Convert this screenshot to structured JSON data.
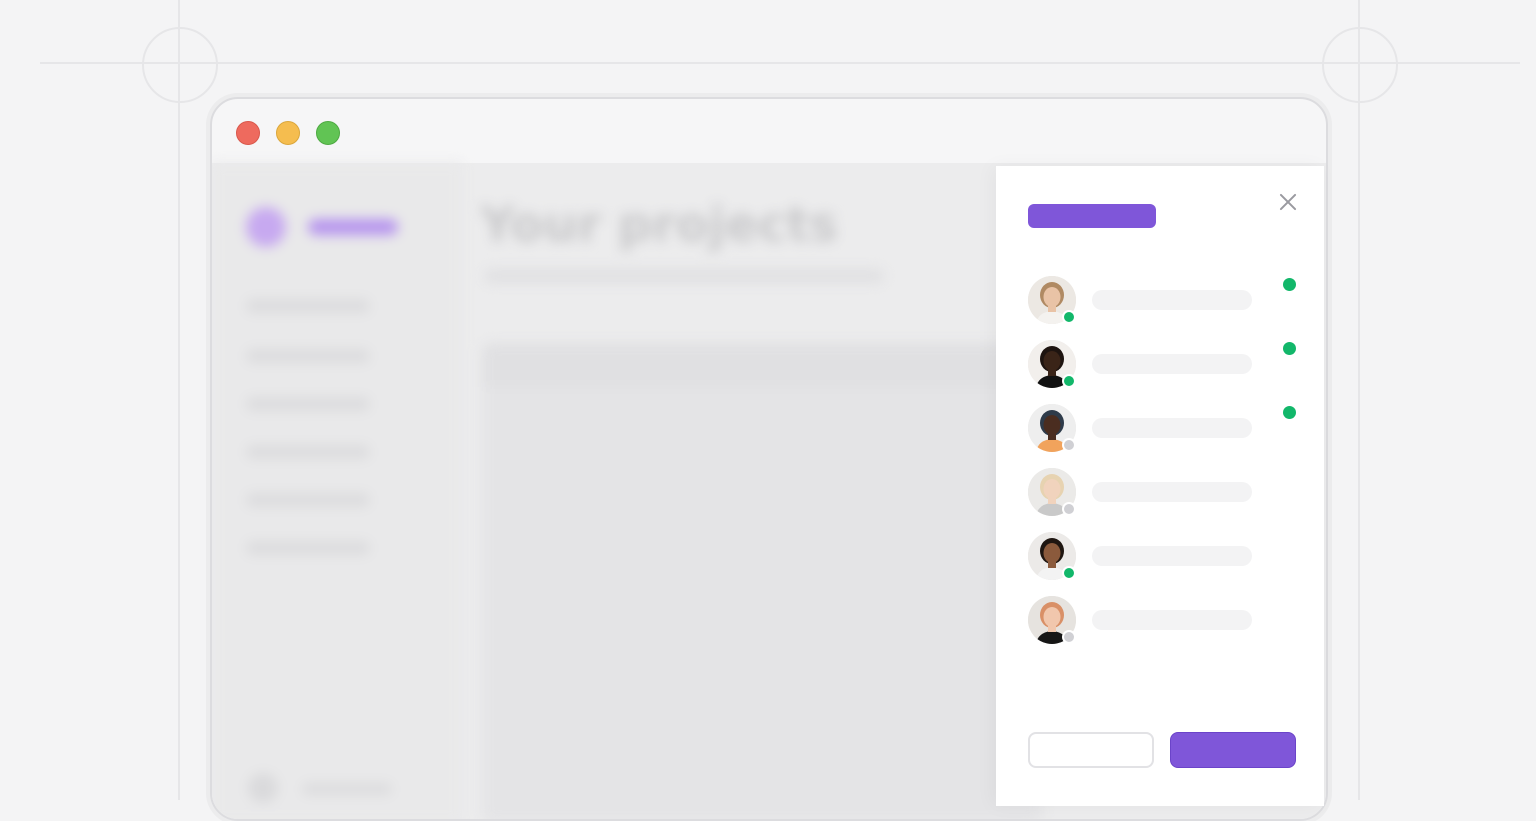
{
  "background_app": {
    "page_title": "Your projects"
  },
  "colors": {
    "accent": "#7f56d9",
    "online": "#12b76a",
    "offline": "#d0d0d4",
    "close_red": "#ee6a5e",
    "minimize_yellow": "#f5bd4f",
    "maximize_green": "#61c454"
  },
  "panel": {
    "close_icon": "close-icon",
    "members": [
      {
        "avatar": "woman-light-hair",
        "presence": "online",
        "status_indicator": true
      },
      {
        "avatar": "man-dark-skin",
        "presence": "online",
        "status_indicator": true
      },
      {
        "avatar": "woman-braids",
        "presence": "offline",
        "status_indicator": true
      },
      {
        "avatar": "woman-blonde",
        "presence": "offline",
        "status_indicator": false
      },
      {
        "avatar": "man-short-hair",
        "presence": "online",
        "status_indicator": false
      },
      {
        "avatar": "woman-red-hair",
        "presence": "offline",
        "status_indicator": false
      }
    ]
  }
}
